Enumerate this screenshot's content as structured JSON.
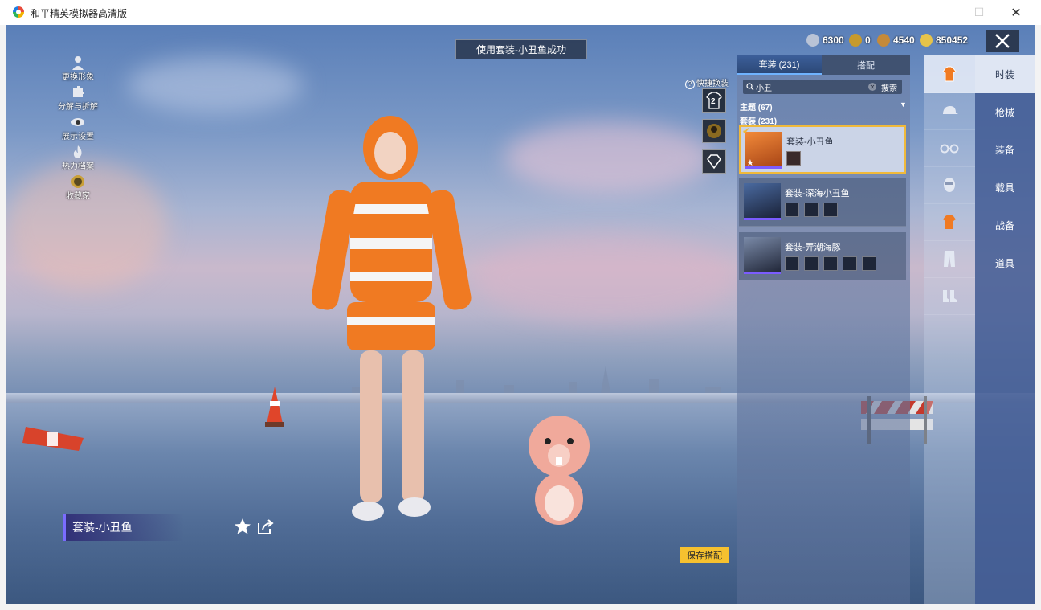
{
  "window": {
    "title": "和平精英模拟器高清版",
    "min_glyph": "—",
    "max_glyph": "☐",
    "close_glyph": "✕"
  },
  "notice": "使用套装-小丑鱼成功",
  "left_menu": [
    {
      "label": "更换形象",
      "icon": "person-icon"
    },
    {
      "label": "分解与拆解",
      "icon": "puzzle-icon"
    },
    {
      "label": "展示设置",
      "icon": "eye-icon"
    },
    {
      "label": "热力档案",
      "icon": "flame-icon"
    },
    {
      "label": "收藏家",
      "icon": "medal-icon"
    }
  ],
  "currencies": [
    {
      "value": "6300",
      "icon": "silver-coin-icon",
      "color": "#b9c3d6"
    },
    {
      "value": "0",
      "icon": "gold-badge-icon",
      "color": "#c79a2c"
    },
    {
      "value": "4540",
      "icon": "bronze-coin-icon",
      "color": "#c58a3a"
    },
    {
      "value": "850452",
      "icon": "gold-coin-icon",
      "color": "#e6c34a"
    }
  ],
  "quick_change": {
    "label": "快捷换装",
    "preset_number": "2"
  },
  "outfit_name": "套装-小丑鱼",
  "save_button": "保存搭配",
  "panel": {
    "tabs": [
      "套装 (231)",
      "搭配"
    ],
    "search": {
      "value": "小丑",
      "button": "搜索"
    },
    "theme": "主题 (67)",
    "section": "套装 (231)",
    "items": [
      {
        "name": "套装-小丑鱼",
        "selected": true,
        "minis": 1
      },
      {
        "name": "套装-深海小丑鱼",
        "selected": false,
        "minis": 3
      },
      {
        "name": "套装-弄潮海豚",
        "selected": false,
        "minis": 5
      }
    ]
  },
  "categories": [
    "outfit-icon",
    "cap-icon",
    "goggles-icon",
    "mask-icon",
    "top-icon",
    "pants-icon",
    "shoes-icon"
  ],
  "side_menu": [
    "时装",
    "枪械",
    "装备",
    "载具",
    "战备",
    "道具"
  ],
  "colors": {
    "accent": "#f6c12f",
    "selected_border": "#f0b93a",
    "menu_bg": "#465f96",
    "rarity": "#7b5cff"
  }
}
